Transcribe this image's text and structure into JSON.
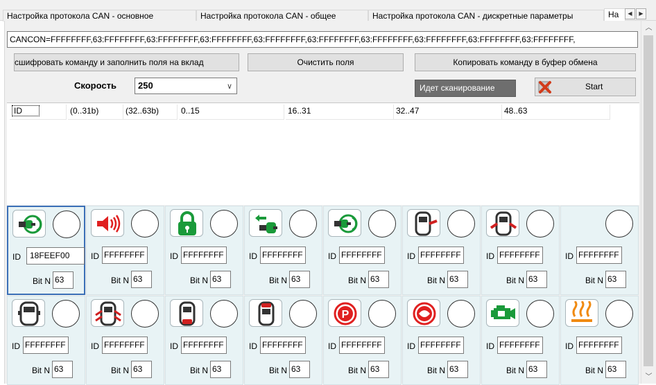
{
  "tabs": [
    "Настройка протокола CAN - основное",
    "Настройка протокола CAN - общее",
    "Настройка протокола CAN - дискретные параметры",
    "На"
  ],
  "command": "CANCON=FFFFFFFF,63:FFFFFFFF,63:FFFFFFFF,63:FFFFFFFF,63:FFFFFFFF,63:FFFFFFFF,63:FFFFFFFF,63:FFFFFFFF,63:FFFFFFFF,63:FFFFFFFF,",
  "buttons": {
    "decode": "сшифровать команду и заполнить поля на вклад",
    "clear": "Очистить поля",
    "copy": "Копировать команду в буфер обмена"
  },
  "speed": {
    "label": "Скорость",
    "value": "250"
  },
  "scan_status": "Идет сканирование",
  "start_label": "Start",
  "grid_headers": [
    "ID",
    "(0..31b)",
    "(32..63b)",
    "0..15",
    "16..31",
    "32..47",
    "48..63"
  ],
  "block_labels": {
    "id": "ID",
    "bit": "Bit N"
  },
  "blocks": [
    {
      "icon": "ignition-key-icon",
      "id": "18FEEF00",
      "bit": "63"
    },
    {
      "icon": "siren-icon",
      "id": "FFFFFFFF",
      "bit": "63"
    },
    {
      "icon": "lock-icon",
      "id": "FFFFFFFF",
      "bit": "63"
    },
    {
      "icon": "key-remove-icon",
      "id": "FFFFFFFF",
      "bit": "63"
    },
    {
      "icon": "ignition-key-icon",
      "id": "FFFFFFFF",
      "bit": "63"
    },
    {
      "icon": "car-door-right-icon",
      "id": "FFFFFFFF",
      "bit": "63"
    },
    {
      "icon": "car-doors-both-icon",
      "id": "FFFFFFFF",
      "bit": "63"
    },
    {
      "icon": "",
      "id": "FFFFFFFF",
      "bit": "63"
    },
    {
      "icon": "car-top-icon",
      "id": "FFFFFFFF",
      "bit": "63"
    },
    {
      "icon": "car-doors-open-icon",
      "id": "FFFFFFFF",
      "bit": "63"
    },
    {
      "icon": "car-trunk-icon",
      "id": "FFFFFFFF",
      "bit": "63"
    },
    {
      "icon": "car-hood-icon",
      "id": "FFFFFFFF",
      "bit": "63"
    },
    {
      "icon": "parking-brake-icon",
      "id": "FFFFFFFF",
      "bit": "63"
    },
    {
      "icon": "brake-warning-icon",
      "id": "FFFFFFFF",
      "bit": "63"
    },
    {
      "icon": "check-engine-icon",
      "id": "FFFFFFFF",
      "bit": "63"
    },
    {
      "icon": "heater-icon",
      "id": "FFFFFFFF",
      "bit": "63"
    }
  ]
}
